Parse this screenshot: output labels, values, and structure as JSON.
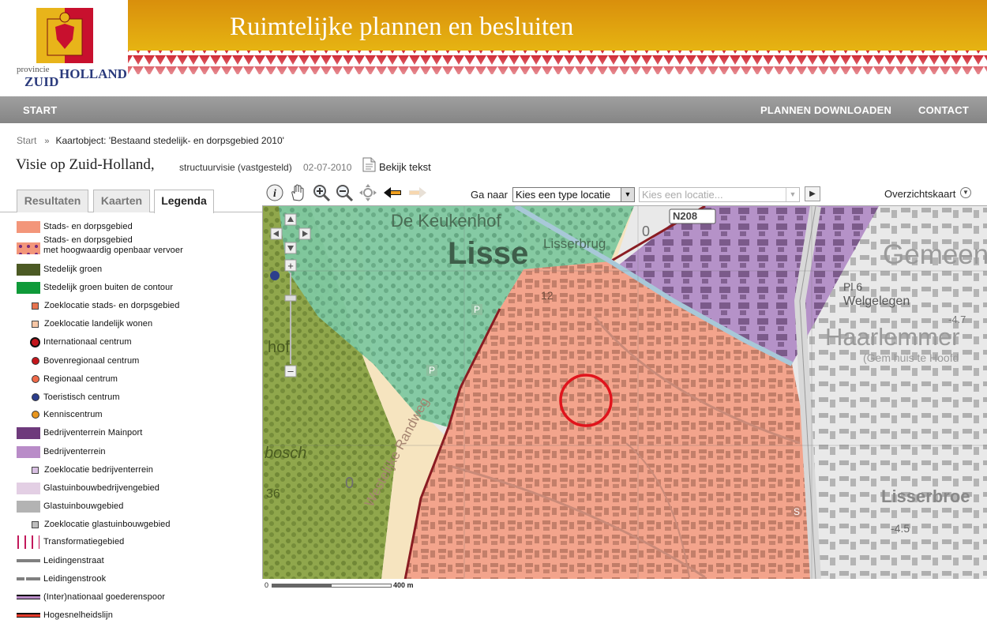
{
  "header": {
    "title": "Ruimtelijke plannen en besluiten",
    "logo_line1": "provincie",
    "logo_line2": "ZUID",
    "logo_line3": "HOLLAND"
  },
  "nav": {
    "start": "START",
    "download": "PLANNEN DOWNLOADEN",
    "contact": "CONTACT"
  },
  "breadcrumb": {
    "start": "Start",
    "separator": "»",
    "current": "Kaartobject: 'Bestaand stedelijk- en dorpsgebied 2010'"
  },
  "plan": {
    "title": "Visie op Zuid-Holland,",
    "type": "structuurvisie (vastgesteld)",
    "date": "02-07-2010",
    "view_text": "Bekijk tekst"
  },
  "tabs": [
    {
      "label": "Resultaten",
      "active": false
    },
    {
      "label": "Kaarten",
      "active": false
    },
    {
      "label": "Legenda",
      "active": true
    }
  ],
  "legend": [
    {
      "label": "Stads- en dorpsgebied",
      "color": "#f3967a",
      "kind": "area"
    },
    {
      "label": "Stads- en dorpsgebied",
      "label2": "met hoogwaardig openbaar vervoer",
      "color": "#f3967a",
      "kind": "area-dots"
    },
    {
      "label": "Stedelijk groen",
      "color": "#4c5a24",
      "kind": "area"
    },
    {
      "label": "Stedelijk groen buiten de contour",
      "color": "#0f9a39",
      "kind": "area"
    },
    {
      "label": "Zoeklocatie stads- en dorpsgebied",
      "color": "#e8734f",
      "kind": "small-square"
    },
    {
      "label": "Zoeklocatie landelijk wonen",
      "color": "#f7c6a5",
      "kind": "small-square"
    },
    {
      "label": "Internationaal centrum",
      "color": "#c4161c",
      "kind": "circle-ring"
    },
    {
      "label": "Bovenregionaal centrum",
      "color": "#c4161c",
      "kind": "circle"
    },
    {
      "label": "Regionaal centrum",
      "color": "#f06a4a",
      "kind": "circle"
    },
    {
      "label": "Toeristisch centrum",
      "color": "#2c3e8c",
      "kind": "circle"
    },
    {
      "label": "Kenniscentrum",
      "color": "#e8961e",
      "kind": "circle"
    },
    {
      "label": "Bedrijventerrein Mainport",
      "color": "#6e3a7c",
      "kind": "area"
    },
    {
      "label": "Bedrijventerrein",
      "color": "#b98cc8",
      "kind": "area"
    },
    {
      "label": "Zoeklocatie bedrijventerrein",
      "color": "#d8bfe2",
      "kind": "small-square"
    },
    {
      "label": "Glastuinbouwbedrijvengebied",
      "color": "#e3cfe4",
      "kind": "area"
    },
    {
      "label": "Glastuinbouwgebied",
      "color": "#b3b3b3",
      "kind": "area"
    },
    {
      "label": "Zoeklocatie glastuinbouwgebied",
      "color": "#bdbdbd",
      "kind": "small-square"
    },
    {
      "label": "Transformatiegebied",
      "color": "#c2185b",
      "kind": "hatch"
    },
    {
      "label": "Leidingenstraat",
      "color": "#808080",
      "kind": "thick-line"
    },
    {
      "label": "Leidingenstrook",
      "color": "#808080",
      "kind": "dash-line"
    },
    {
      "label": "(Inter)nationaal goederenspoor",
      "color": "#b98cc8",
      "kind": "rail"
    },
    {
      "label": "Hogesnelheidslijn",
      "color": "#e53b2c",
      "kind": "rail-red"
    }
  ],
  "map_toolbar": {
    "goto_label": "Ga naar",
    "type_select": "Kies een type locatie",
    "location_placeholder": "Kies een locatie...",
    "overview": "Overzichtskaart"
  },
  "map": {
    "labels": {
      "keukenhof": "De Keukenhof",
      "lisse": "Lisse",
      "lisserbrug": "Lisserbrug",
      "road": "N208",
      "gemeente": "Gemeen",
      "pl6": "Pl 6",
      "welgelegen": "Welgelegen",
      "haarlemmer": "Haarlemmer",
      "gem_huis": "(Gem huis te Hoofd",
      "lisserbroek": "Lisserbroe",
      "elev_47": "-4.7",
      "elev_45": "-4.5",
      "wrandweg": "Westelijke Randweg",
      "num12": "12",
      "bosch": "bosch",
      "hof": "hof",
      "p1": "P",
      "p2": "P",
      "zero": "0",
      "zero2": "0",
      "num36": "36",
      "s": "S"
    }
  },
  "scale": {
    "start": "0",
    "end": "400 m"
  },
  "colors": {
    "urban": "#f3a48c",
    "green": "#78c59b",
    "forest": "#8aa34a",
    "sand": "#f6e3bc",
    "business": "#b592c8",
    "marker": "#e0141c"
  }
}
